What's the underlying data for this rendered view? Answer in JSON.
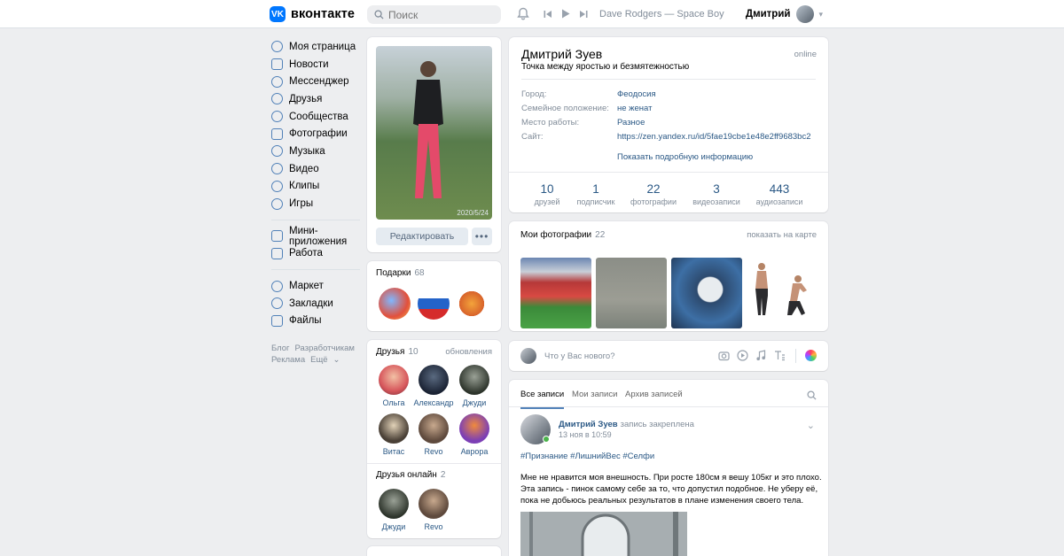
{
  "topbar": {
    "logo_mark": "VK",
    "logo_text": "вконтакте",
    "search_placeholder": "Поиск",
    "now_playing": "Dave Rodgers — Space Boy",
    "user_name": "Дмитрий"
  },
  "nav": {
    "items": [
      {
        "label": "Моя страница",
        "icon": "user-icon"
      },
      {
        "label": "Новости",
        "icon": "news-icon"
      },
      {
        "label": "Мессенджер",
        "icon": "message-icon"
      },
      {
        "label": "Друзья",
        "icon": "friends-icon"
      },
      {
        "label": "Сообщества",
        "icon": "groups-icon"
      },
      {
        "label": "Фотографии",
        "icon": "photo-icon"
      },
      {
        "label": "Музыка",
        "icon": "music-icon"
      },
      {
        "label": "Видео",
        "icon": "video-icon"
      },
      {
        "label": "Клипы",
        "icon": "clips-icon"
      },
      {
        "label": "Игры",
        "icon": "games-icon"
      }
    ],
    "items2": [
      {
        "label": "Мини-приложения",
        "icon": "apps-icon"
      },
      {
        "label": "Работа",
        "icon": "work-icon"
      }
    ],
    "items3": [
      {
        "label": "Маркет",
        "icon": "market-icon"
      },
      {
        "label": "Закладки",
        "icon": "bookmark-icon"
      },
      {
        "label": "Файлы",
        "icon": "files-icon"
      }
    ],
    "footer": [
      "Блог",
      "Разработчикам",
      "Реклама",
      "Ещё"
    ]
  },
  "profile": {
    "photo_date": "2020/5/24",
    "edit_label": "Редактировать",
    "more_label": "•••",
    "name": "Дмитрий Зуев",
    "status": "Точка между яростью и безмятежностью",
    "online": "online",
    "info": [
      {
        "label": "Город:",
        "value": "Феодосия"
      },
      {
        "label": "Семейное положение:",
        "value": "не женат"
      },
      {
        "label": "Место работы:",
        "value": "Разное"
      },
      {
        "label": "Сайт:",
        "value": "https://zen.yandex.ru/id/5fae19cbe1e48e2ff9683bc2"
      }
    ],
    "more_info": "Показать подробную информацию",
    "stats": [
      {
        "n": "10",
        "l": "друзей"
      },
      {
        "n": "1",
        "l": "подписчик"
      },
      {
        "n": "22",
        "l": "фотографии"
      },
      {
        "n": "3",
        "l": "видеозаписи"
      },
      {
        "n": "443",
        "l": "аудиозаписи"
      }
    ]
  },
  "gifts": {
    "title": "Подарки",
    "count": "68"
  },
  "friends": {
    "title": "Друзья",
    "count": "10",
    "updates": "обновления",
    "list": [
      "Ольга",
      "Александр",
      "Джуди",
      "Витас",
      "Revo",
      "Аврора"
    ],
    "online_title": "Друзья онлайн",
    "online_count": "2",
    "online_list": [
      "Джуди",
      "Revo"
    ]
  },
  "photos": {
    "title": "Мои фотографии",
    "count": "22",
    "map_link": "показать на карте"
  },
  "composer": {
    "placeholder": "Что у Вас нового?"
  },
  "wall": {
    "tabs": [
      "Все записи",
      "Мои записи",
      "Архив записей"
    ],
    "post": {
      "author": "Дмитрий Зуев",
      "pinned": "запись закреплена",
      "date": "13 ноя в 10:59",
      "tags": "#Признание #ЛишнийВес #Селфи",
      "text": "Мне не нравится моя внешность. При росте 180см я вешу 105кг и это плохо. Эта запись - пинок самому себе за то, что допустил подобное. Не уберу её, пока не добьюсь реальных результатов в плане изменения своего тела."
    }
  },
  "colors": {
    "accent": "#5181b8",
    "link": "#2a5885",
    "brand": "#0077ff",
    "background": "#edeef0"
  }
}
